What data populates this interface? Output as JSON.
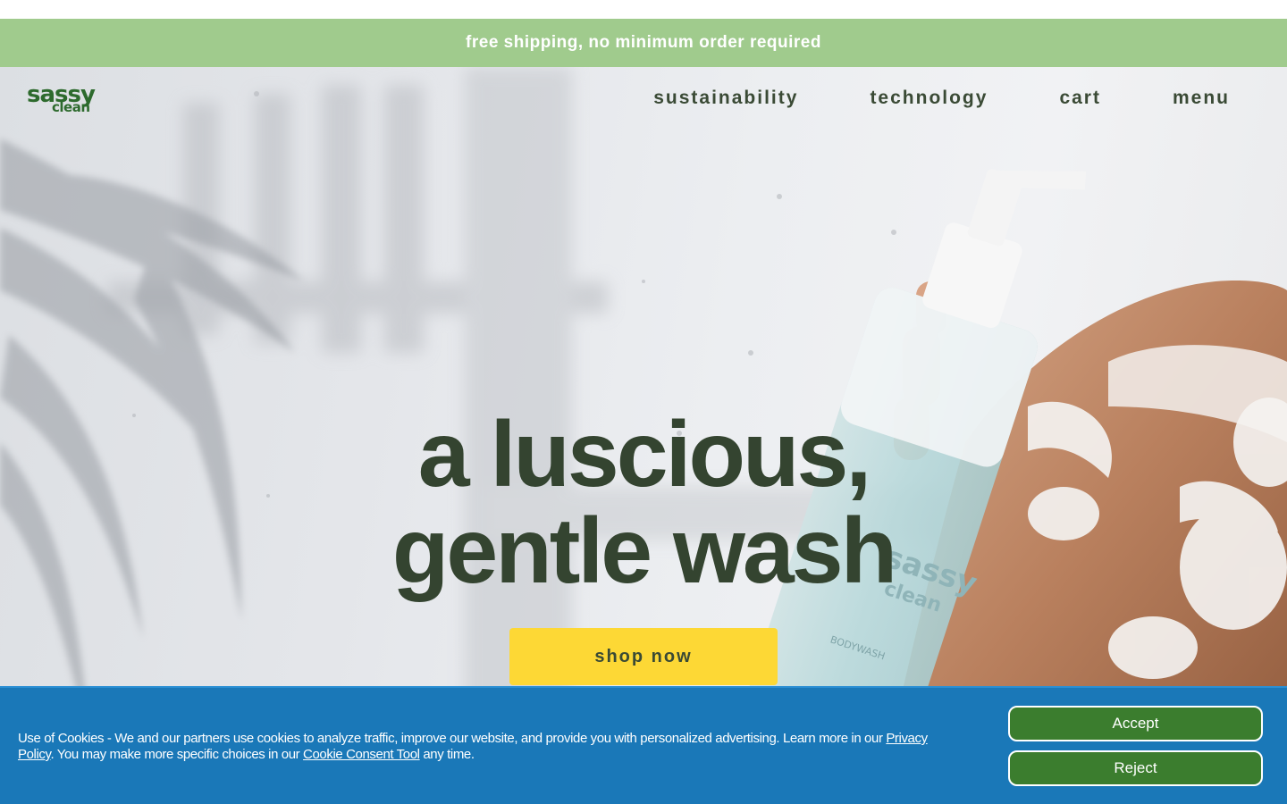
{
  "announcement": {
    "text": "free shipping, no minimum order required"
  },
  "header": {
    "logo_line1": "sassy",
    "logo_line2": "clean",
    "nav": [
      "sustainability",
      "technology",
      "cart",
      "menu"
    ]
  },
  "hero": {
    "headline_line1": "a luscious,",
    "headline_line2": "gentle wash",
    "cta_label": "shop now",
    "bottle_brand_line1": "sassy",
    "bottle_brand_line2": "clean",
    "bottle_label": "BODYWASH"
  },
  "cookie_banner": {
    "text_before_privacy": "Use of Cookies - We and our partners use cookies to analyze traffic, improve our website, and provide you with personalized advertising. Learn more in our ",
    "privacy_link": "Privacy Policy",
    "text_middle": ". You may make more specific choices in our ",
    "consent_link": "Cookie Consent Tool",
    "text_after": " any time.",
    "accept_label": "Accept",
    "reject_label": "Reject"
  },
  "colors": {
    "announcement_bg": "#a0cb8d",
    "brand_green": "#2d6a2d",
    "headline_text": "#344430",
    "cta_bg": "#fdd835",
    "cookie_bg": "#1a78b8",
    "cookie_button_bg": "#3b7d2e"
  }
}
